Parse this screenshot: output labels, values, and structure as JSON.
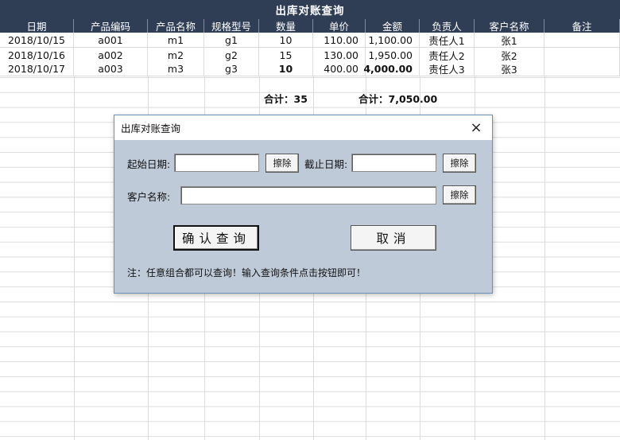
{
  "sheet": {
    "title": "出库对账查询",
    "headers": [
      "日期",
      "产品编码",
      "产品名称",
      "规格型号",
      "数量",
      "单价",
      "金额",
      "负责人",
      "客户名称",
      "备注"
    ],
    "rows": [
      {
        "date": "2018/10/15",
        "code": "a001",
        "name": "m1",
        "spec": "g1",
        "qty": "10",
        "price": "110.00",
        "amount": "1,100.00",
        "owner": "责任人1",
        "customer": "张1",
        "note": ""
      },
      {
        "date": "2018/10/16",
        "code": "a002",
        "name": "m2",
        "spec": "g2",
        "qty": "15",
        "price": "130.00",
        "amount": "1,950.00",
        "owner": "责任人2",
        "customer": "张2",
        "note": ""
      },
      {
        "date": "2018/10/17",
        "code": "a003",
        "name": "m3",
        "spec": "g3",
        "qty": "10",
        "price": "400.00",
        "amount": "4,000.00",
        "owner": "责任人3",
        "customer": "张3",
        "note": ""
      }
    ],
    "total_qty_label": "合计：35",
    "total_amount_label": "合计：7,050.00",
    "header_color": "#2f3d55"
  },
  "dialog": {
    "title": "出库对账查询",
    "close_icon": "×",
    "start_date_label": "起始日期:",
    "start_date_value": "",
    "end_date_label": "截止日期:",
    "end_date_value": "",
    "customer_label": "客户名称:",
    "customer_value": "",
    "clear_label": "擦除",
    "confirm_label": "确认查询",
    "cancel_label": "取消",
    "note": "注：任意组合都可以查询！输入查询条件点击按钮即可！",
    "background_color": "#bfcad8"
  }
}
